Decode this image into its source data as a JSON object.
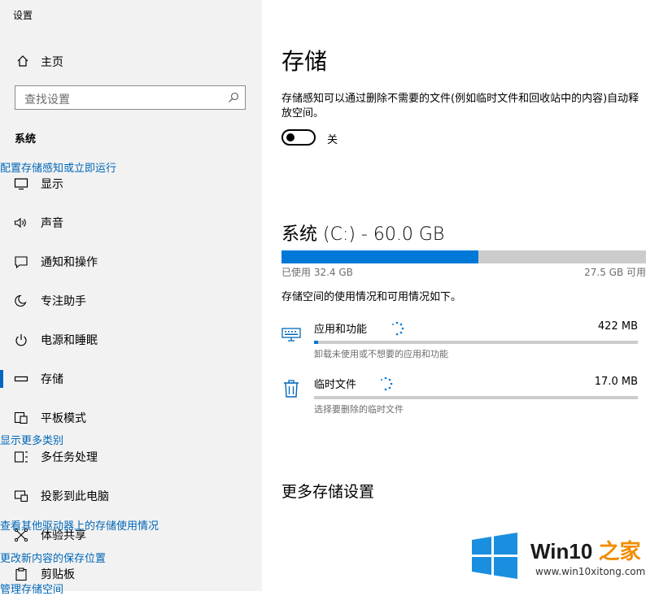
{
  "app_title": "设置",
  "sidebar": {
    "home_label": "主页",
    "search_placeholder": "查找设置",
    "section_heading": "系统",
    "items": [
      {
        "label": "显示",
        "icon": "monitor-icon"
      },
      {
        "label": "声音",
        "icon": "speaker-icon"
      },
      {
        "label": "通知和操作",
        "icon": "notification-icon"
      },
      {
        "label": "专注助手",
        "icon": "moon-icon"
      },
      {
        "label": "电源和睡眠",
        "icon": "power-icon"
      },
      {
        "label": "存储",
        "icon": "storage-icon",
        "active": true
      },
      {
        "label": "平板模式",
        "icon": "tablet-mode-icon"
      },
      {
        "label": "多任务处理",
        "icon": "multitasking-icon"
      },
      {
        "label": "投影到此电脑",
        "icon": "projection-icon"
      },
      {
        "label": "体验共享",
        "icon": "shared-experiences-icon"
      },
      {
        "label": "剪贴板",
        "icon": "clipboard-icon"
      }
    ]
  },
  "main": {
    "title": "存储",
    "storage_sense_desc": "存储感知可以通过删除不需要的文件(例如临时文件和回收站中的内容)自动释放空间。",
    "toggle_state": "关",
    "configure_link": "配置存储感知或立即运行",
    "drive": {
      "title": "系统 (C:) - 60.0 GB",
      "used_label": "已使用 32.4 GB",
      "free_label": "27.5 GB 可用",
      "used_fraction": 0.54
    },
    "usage_desc": "存储空间的使用情况和可用情况如下。",
    "categories": [
      {
        "name": "应用和功能",
        "size": "422 MB",
        "sub": "卸载未使用或不想要的应用和功能",
        "fraction": 0.012,
        "icon": "keyboard-icon"
      },
      {
        "name": "临时文件",
        "size": "17.0 MB",
        "sub": "选择要删除的临时文件",
        "fraction": 0.0,
        "icon": "trash-icon"
      }
    ],
    "show_more_link": "显示更多类别",
    "more_settings_heading": "更多存储设置",
    "links": [
      "查看其他驱动器上的存储使用情况",
      "更改新内容的保存位置",
      "管理存储空间"
    ]
  },
  "watermark": {
    "brand_prefix": "Win10",
    "brand_suffix": " 之家",
    "url": "www.win10xitong.com"
  },
  "colors": {
    "accent": "#0078d7",
    "link": "#0067b8",
    "sidebar_bg": "#f2f2f2"
  }
}
